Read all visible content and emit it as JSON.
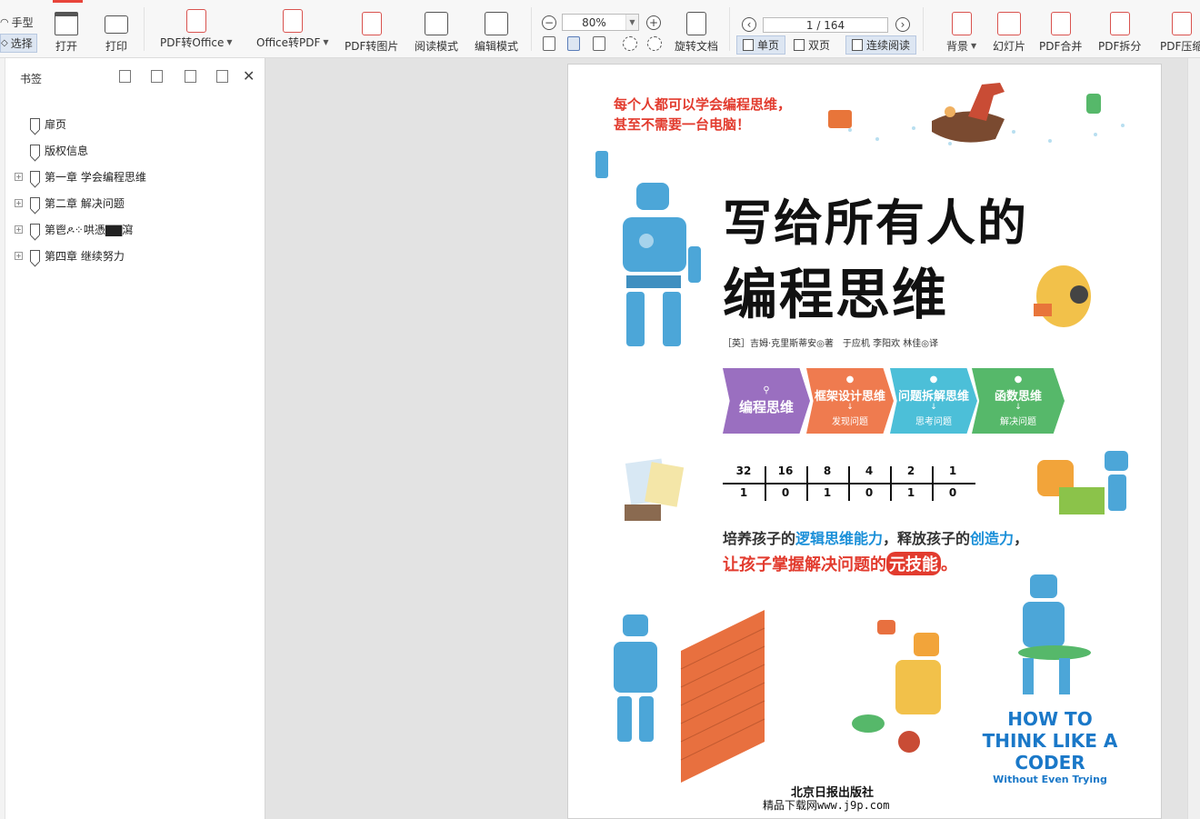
{
  "toolbar": {
    "modes": [
      "手型",
      "选择"
    ],
    "buttons": {
      "open": "打开",
      "print": "打印",
      "pdf_to_office": "PDF转Office",
      "office_to_pdf": "Office转PDF",
      "pdf_to_image": "PDF转图片",
      "read_mode": "阅读模式",
      "edit_mode": "编辑模式",
      "rotate_doc": "旋转文档",
      "background": "背景",
      "slideshow": "幻灯片",
      "pdf_merge": "PDF合并",
      "pdf_split": "PDF拆分",
      "pdf_compress": "PDF压缩"
    },
    "zoom": "80%",
    "page_indicator": "1 / 164",
    "view_modes": [
      "单页",
      "双页",
      "连续阅读"
    ],
    "accent_color": "#e8443a"
  },
  "sidebar": {
    "title": "书签",
    "bookmarks": [
      {
        "label": "扉页",
        "expandable": false
      },
      {
        "label": "版权信息",
        "expandable": false
      },
      {
        "label": "第一章 学会编程思维",
        "expandable": true
      },
      {
        "label": "第二章 解决问题",
        "expandable": true
      },
      {
        "label": "第鬯ዶ⁘哄憑▇▇瀉",
        "expandable": true
      },
      {
        "label": "第四章 继续努力",
        "expandable": true
      }
    ]
  },
  "cover": {
    "tagline": [
      "每个人都可以学会编程思维，",
      "甚至不需要一台电脑！"
    ],
    "title_line1": "写给所有人的",
    "title_line2": "编程思维",
    "authors": "［英］吉姆·克里斯蒂安◎著　于应机  李阳欢  林佳◎译",
    "chevrons": [
      {
        "main": "编程思维",
        "sub": "",
        "color": "#9a6fc0"
      },
      {
        "main": "框架设计思维",
        "sub": "发现问题",
        "color": "#ef7b4f"
      },
      {
        "main": "问题拆解思维",
        "sub": "思考问题",
        "color": "#4cbfd8"
      },
      {
        "main": "函数思维",
        "sub": "解决问题",
        "color": "#56b86a"
      }
    ],
    "binary_top": [
      "32",
      "16",
      "8",
      "4",
      "2",
      "1"
    ],
    "binary_bottom": [
      "1",
      "0",
      "1",
      "0",
      "1",
      "0"
    ],
    "slogan1_a": "培养孩子的",
    "slogan1_b": "逻辑思维能力",
    "slogan1_c": "，释放孩子的",
    "slogan1_d": "创造力",
    "slogan1_e": "，",
    "slogan2_a": "让孩子掌握解决问题的",
    "slogan2_b": "元技能",
    "slogan2_c": "。",
    "english_title": [
      "HOW TO",
      "THINK LIKE A",
      "CODER"
    ],
    "english_sub": "Without Even Trying",
    "publisher": "北京日报出版社",
    "watermark": "精品下载网www.j9p.com"
  }
}
